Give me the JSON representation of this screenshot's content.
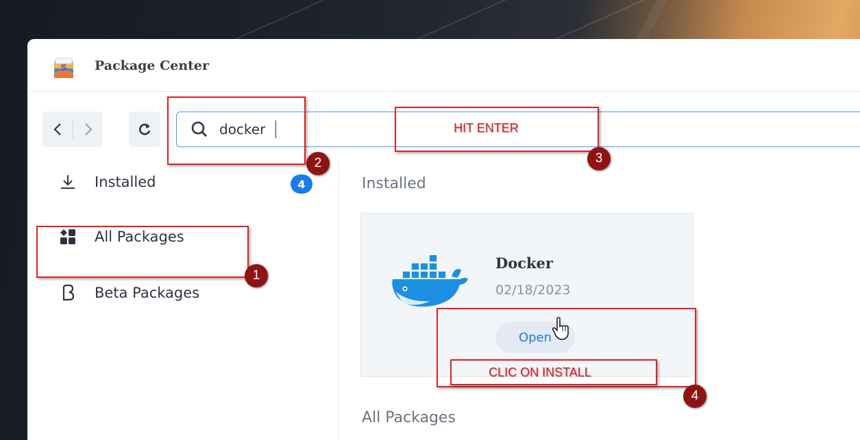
{
  "window": {
    "title": "Package Center"
  },
  "toolbar": {
    "back_icon": "chevron-left-icon",
    "forward_icon": "chevron-right-icon",
    "refresh_icon": "refresh-icon",
    "search_icon": "search-icon",
    "search_value": "docker"
  },
  "sidebar": {
    "items": [
      {
        "label": "Installed",
        "icon": "download-icon",
        "badge": "4"
      },
      {
        "label": "All Packages",
        "icon": "grid-icon"
      },
      {
        "label": "Beta Packages",
        "icon": "beta-icon"
      }
    ]
  },
  "content": {
    "installed_heading": "Installed",
    "all_packages_heading": "All Packages",
    "package": {
      "name": "Docker",
      "date": "02/18/2023",
      "button_label": "Open"
    }
  },
  "annotations": {
    "hit_enter": "HIT ENTER",
    "clic_on_install": "CLIC ON INSTALL",
    "steps": [
      "1",
      "2",
      "3",
      "4"
    ]
  },
  "colors": {
    "accent": "#1a7ce8",
    "annotation_red": "#e02020",
    "step_badge": "#8e1414"
  }
}
